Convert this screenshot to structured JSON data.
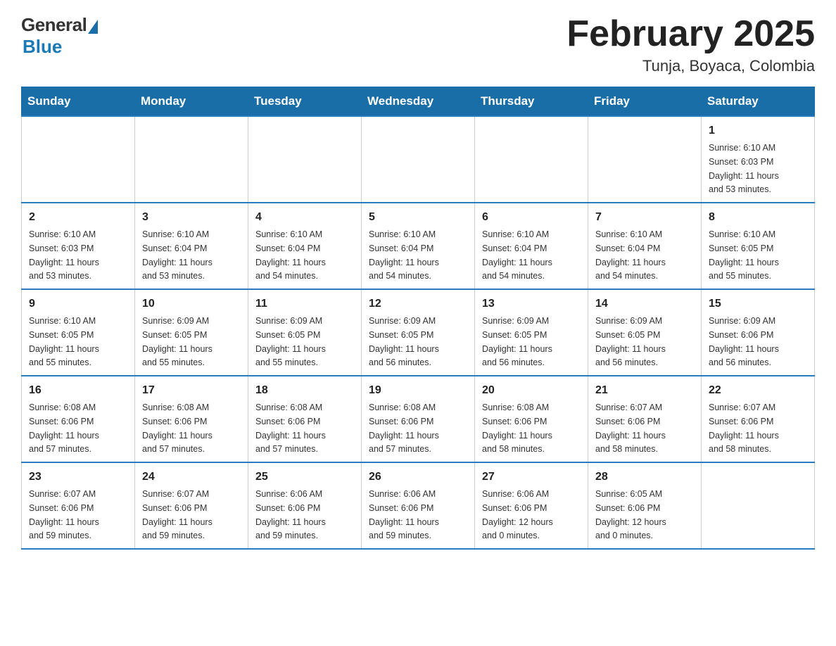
{
  "header": {
    "logo": {
      "general": "General",
      "blue": "Blue"
    },
    "title": "February 2025",
    "location": "Tunja, Boyaca, Colombia"
  },
  "weekdays": [
    "Sunday",
    "Monday",
    "Tuesday",
    "Wednesday",
    "Thursday",
    "Friday",
    "Saturday"
  ],
  "weeks": [
    [
      {
        "day": "",
        "info": ""
      },
      {
        "day": "",
        "info": ""
      },
      {
        "day": "",
        "info": ""
      },
      {
        "day": "",
        "info": ""
      },
      {
        "day": "",
        "info": ""
      },
      {
        "day": "",
        "info": ""
      },
      {
        "day": "1",
        "info": "Sunrise: 6:10 AM\nSunset: 6:03 PM\nDaylight: 11 hours\nand 53 minutes."
      }
    ],
    [
      {
        "day": "2",
        "info": "Sunrise: 6:10 AM\nSunset: 6:03 PM\nDaylight: 11 hours\nand 53 minutes."
      },
      {
        "day": "3",
        "info": "Sunrise: 6:10 AM\nSunset: 6:04 PM\nDaylight: 11 hours\nand 53 minutes."
      },
      {
        "day": "4",
        "info": "Sunrise: 6:10 AM\nSunset: 6:04 PM\nDaylight: 11 hours\nand 54 minutes."
      },
      {
        "day": "5",
        "info": "Sunrise: 6:10 AM\nSunset: 6:04 PM\nDaylight: 11 hours\nand 54 minutes."
      },
      {
        "day": "6",
        "info": "Sunrise: 6:10 AM\nSunset: 6:04 PM\nDaylight: 11 hours\nand 54 minutes."
      },
      {
        "day": "7",
        "info": "Sunrise: 6:10 AM\nSunset: 6:04 PM\nDaylight: 11 hours\nand 54 minutes."
      },
      {
        "day": "8",
        "info": "Sunrise: 6:10 AM\nSunset: 6:05 PM\nDaylight: 11 hours\nand 55 minutes."
      }
    ],
    [
      {
        "day": "9",
        "info": "Sunrise: 6:10 AM\nSunset: 6:05 PM\nDaylight: 11 hours\nand 55 minutes."
      },
      {
        "day": "10",
        "info": "Sunrise: 6:09 AM\nSunset: 6:05 PM\nDaylight: 11 hours\nand 55 minutes."
      },
      {
        "day": "11",
        "info": "Sunrise: 6:09 AM\nSunset: 6:05 PM\nDaylight: 11 hours\nand 55 minutes."
      },
      {
        "day": "12",
        "info": "Sunrise: 6:09 AM\nSunset: 6:05 PM\nDaylight: 11 hours\nand 56 minutes."
      },
      {
        "day": "13",
        "info": "Sunrise: 6:09 AM\nSunset: 6:05 PM\nDaylight: 11 hours\nand 56 minutes."
      },
      {
        "day": "14",
        "info": "Sunrise: 6:09 AM\nSunset: 6:05 PM\nDaylight: 11 hours\nand 56 minutes."
      },
      {
        "day": "15",
        "info": "Sunrise: 6:09 AM\nSunset: 6:06 PM\nDaylight: 11 hours\nand 56 minutes."
      }
    ],
    [
      {
        "day": "16",
        "info": "Sunrise: 6:08 AM\nSunset: 6:06 PM\nDaylight: 11 hours\nand 57 minutes."
      },
      {
        "day": "17",
        "info": "Sunrise: 6:08 AM\nSunset: 6:06 PM\nDaylight: 11 hours\nand 57 minutes."
      },
      {
        "day": "18",
        "info": "Sunrise: 6:08 AM\nSunset: 6:06 PM\nDaylight: 11 hours\nand 57 minutes."
      },
      {
        "day": "19",
        "info": "Sunrise: 6:08 AM\nSunset: 6:06 PM\nDaylight: 11 hours\nand 57 minutes."
      },
      {
        "day": "20",
        "info": "Sunrise: 6:08 AM\nSunset: 6:06 PM\nDaylight: 11 hours\nand 58 minutes."
      },
      {
        "day": "21",
        "info": "Sunrise: 6:07 AM\nSunset: 6:06 PM\nDaylight: 11 hours\nand 58 minutes."
      },
      {
        "day": "22",
        "info": "Sunrise: 6:07 AM\nSunset: 6:06 PM\nDaylight: 11 hours\nand 58 minutes."
      }
    ],
    [
      {
        "day": "23",
        "info": "Sunrise: 6:07 AM\nSunset: 6:06 PM\nDaylight: 11 hours\nand 59 minutes."
      },
      {
        "day": "24",
        "info": "Sunrise: 6:07 AM\nSunset: 6:06 PM\nDaylight: 11 hours\nand 59 minutes."
      },
      {
        "day": "25",
        "info": "Sunrise: 6:06 AM\nSunset: 6:06 PM\nDaylight: 11 hours\nand 59 minutes."
      },
      {
        "day": "26",
        "info": "Sunrise: 6:06 AM\nSunset: 6:06 PM\nDaylight: 11 hours\nand 59 minutes."
      },
      {
        "day": "27",
        "info": "Sunrise: 6:06 AM\nSunset: 6:06 PM\nDaylight: 12 hours\nand 0 minutes."
      },
      {
        "day": "28",
        "info": "Sunrise: 6:05 AM\nSunset: 6:06 PM\nDaylight: 12 hours\nand 0 minutes."
      },
      {
        "day": "",
        "info": ""
      }
    ]
  ]
}
